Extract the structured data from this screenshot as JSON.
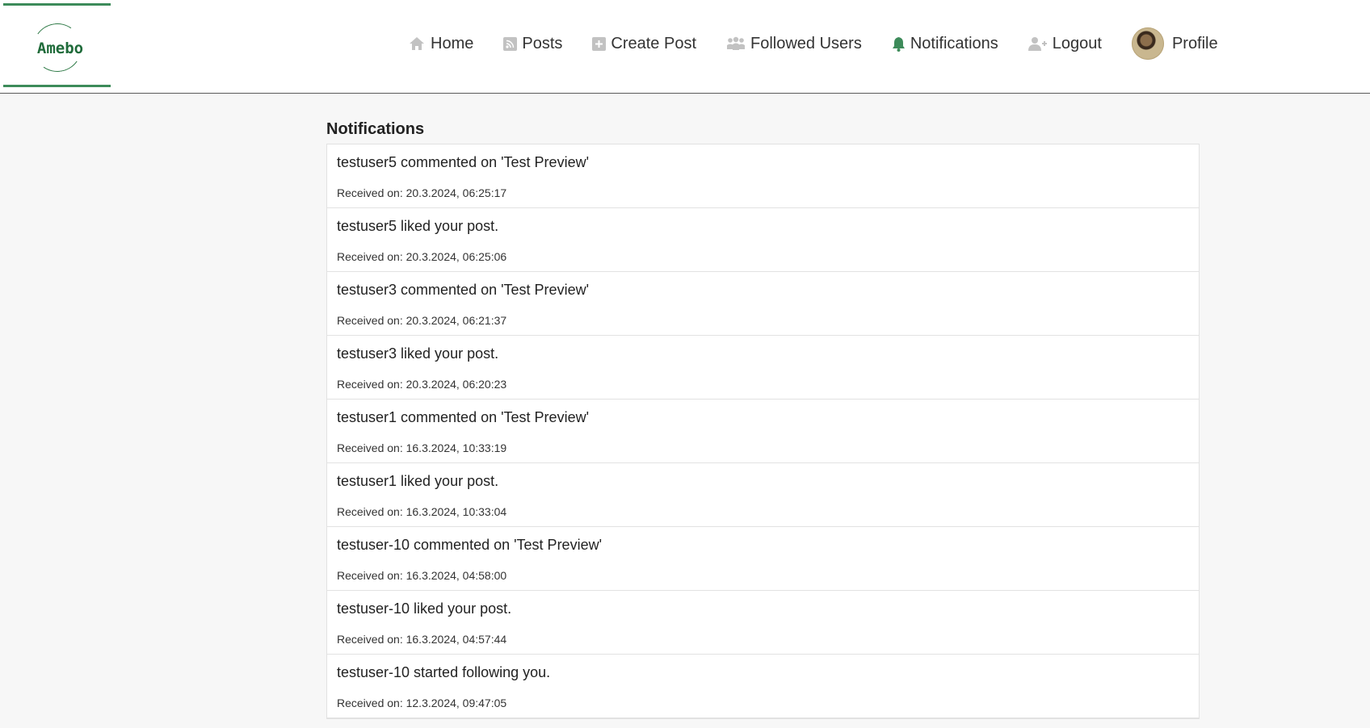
{
  "logo": {
    "text": "Amebo"
  },
  "nav": {
    "items": [
      {
        "label": "Home",
        "icon": "home-icon"
      },
      {
        "label": "Posts",
        "icon": "rss-icon"
      },
      {
        "label": "Create Post",
        "icon": "plus-square-icon"
      },
      {
        "label": "Followed Users",
        "icon": "users-icon"
      },
      {
        "label": "Notifications",
        "icon": "bell-icon",
        "active": true
      },
      {
        "label": "Logout",
        "icon": "user-plus-icon"
      }
    ],
    "profile_label": "Profile"
  },
  "colors": {
    "brand": "#3d8b5a",
    "active_icon": "#3d8b5a",
    "icon": "#c2c2c2"
  },
  "notifications": {
    "title": "Notifications",
    "items": [
      {
        "message": "testuser5 commented on 'Test Preview'",
        "time": "Received on: 20.3.2024, 06:25:17"
      },
      {
        "message": "testuser5 liked your post.",
        "time": "Received on: 20.3.2024, 06:25:06"
      },
      {
        "message": "testuser3 commented on 'Test Preview'",
        "time": "Received on: 20.3.2024, 06:21:37"
      },
      {
        "message": "testuser3 liked your post.",
        "time": "Received on: 20.3.2024, 06:20:23"
      },
      {
        "message": "testuser1 commented on 'Test Preview'",
        "time": "Received on: 16.3.2024, 10:33:19"
      },
      {
        "message": "testuser1 liked your post.",
        "time": "Received on: 16.3.2024, 10:33:04"
      },
      {
        "message": "testuser-10 commented on 'Test Preview'",
        "time": "Received on: 16.3.2024, 04:58:00"
      },
      {
        "message": "testuser-10 liked your post.",
        "time": "Received on: 16.3.2024, 04:57:44"
      },
      {
        "message": "testuser-10 started following you.",
        "time": "Received on: 12.3.2024, 09:47:05"
      }
    ]
  }
}
